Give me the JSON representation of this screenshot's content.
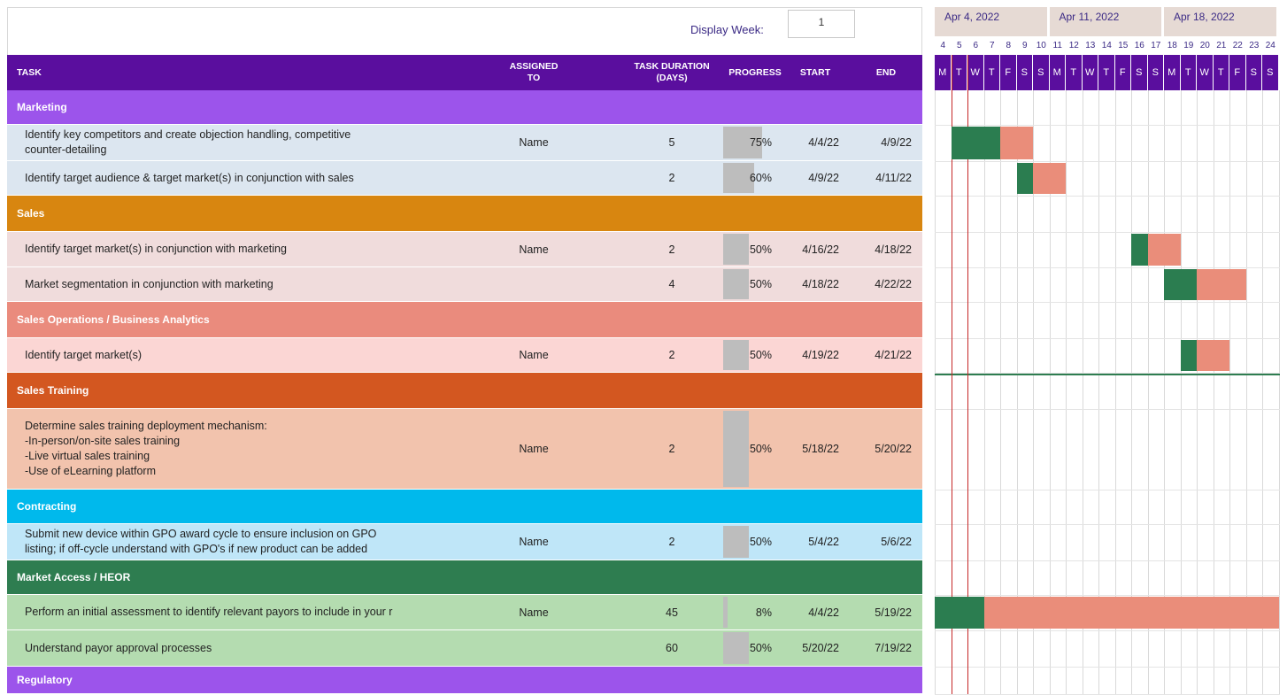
{
  "display_week": {
    "label": "Display Week:",
    "value": "1"
  },
  "columns": {
    "task": "TASK",
    "assigned_to": "ASSIGNED\nTO",
    "duration": "TASK DURATION\n(DAYS)",
    "progress": "PROGRESS",
    "start": "START",
    "end": "END"
  },
  "timeline": {
    "weeks": [
      "Apr 4, 2022",
      "Apr 11, 2022",
      "Apr 18, 2022"
    ],
    "day_numbers": [
      "4",
      "5",
      "6",
      "7",
      "8",
      "9",
      "10",
      "11",
      "12",
      "13",
      "14",
      "15",
      "16",
      "17",
      "18",
      "19",
      "20",
      "21",
      "22",
      "23",
      "24"
    ],
    "day_letters": [
      "M",
      "T",
      "W",
      "T",
      "F",
      "S",
      "S",
      "M",
      "T",
      "W",
      "T",
      "F",
      "S",
      "S",
      "M",
      "T",
      "W",
      "T",
      "F",
      "S",
      "S"
    ]
  },
  "colors": {
    "header": "#5a0e9e",
    "done_bar": "#2b7d50",
    "remaining_bar": "#ea8d7a",
    "today_line": "#c62828"
  },
  "rows": [
    {
      "type": "category",
      "name": "Marketing",
      "color": "#9c54eb"
    },
    {
      "type": "task",
      "task": "Identify key competitors and create objection handling, competitive\ncounter-detailing",
      "assigned": "Name",
      "duration": "5",
      "progress": 0.75,
      "progress_label": "75%",
      "start": "4/4/22",
      "end": "4/9/22",
      "bg": "#dce6f0"
    },
    {
      "type": "task",
      "task": "Identify target audience & target market(s) in conjunction with sales",
      "assigned": "",
      "duration": "2",
      "progress": 0.6,
      "progress_label": "60%",
      "start": "4/9/22",
      "end": "4/11/22",
      "bg": "#dce6f0"
    },
    {
      "type": "category",
      "name": "Sales",
      "color": "#d88610"
    },
    {
      "type": "task",
      "task": "Identify target market(s) in conjunction with marketing",
      "assigned": "Name",
      "duration": "2",
      "progress": 0.5,
      "progress_label": "50%",
      "start": "4/16/22",
      "end": "4/18/22",
      "bg": "#f0dcdc"
    },
    {
      "type": "task",
      "task": "Market segmentation in conjunction with marketing",
      "assigned": "",
      "duration": "4",
      "progress": 0.5,
      "progress_label": "50%",
      "start": "4/18/22",
      "end": "4/22/22",
      "bg": "#f0dcdc"
    },
    {
      "type": "category",
      "name": "Sales Operations / Business Analytics",
      "color": "#ea8b7d"
    },
    {
      "type": "task",
      "task": "Identify target market(s)",
      "assigned": "Name",
      "duration": "2",
      "progress": 0.5,
      "progress_label": "50%",
      "start": "4/19/22",
      "end": "4/21/22",
      "bg": "#fbd6d4"
    },
    {
      "type": "category",
      "name": "Sales Training",
      "color": "#d35720"
    },
    {
      "type": "task",
      "task": "Determine sales training deployment mechanism:\n-In-person/on-site sales training\n-Live virtual sales training\n-Use of eLearning platform",
      "assigned": "Name",
      "duration": "2",
      "progress": 0.5,
      "progress_label": "50%",
      "start": "5/18/22",
      "end": "5/20/22",
      "bg": "#f2c3ad"
    },
    {
      "type": "category",
      "name": "Contracting",
      "color": "#00b9ec"
    },
    {
      "type": "task",
      "task": "Submit new device within GPO award cycle to ensure inclusion on GPO\nlisting; if off-cycle understand with GPO's if new product can be added",
      "assigned": "Name",
      "duration": "2",
      "progress": 0.5,
      "progress_label": "50%",
      "start": "5/4/22",
      "end": "5/6/22",
      "bg": "#bfe6f8"
    },
    {
      "type": "category",
      "name": "Market Access / HEOR",
      "color": "#2e7d50"
    },
    {
      "type": "task",
      "task": "Perform an initial assessment to identify relevant payors to include in your r",
      "assigned": "Name",
      "duration": "45",
      "progress": 0.08,
      "progress_label": "8%",
      "start": "4/4/22",
      "end": "5/19/22",
      "bg": "#b4dcb0"
    },
    {
      "type": "task",
      "task": "Understand payor approval processes",
      "assigned": "",
      "duration": "60",
      "progress": 0.5,
      "progress_label": "50%",
      "start": "5/20/22",
      "end": "7/19/22",
      "bg": "#b4dcb0"
    },
    {
      "type": "category",
      "name": "Regulatory",
      "color": "#9c54eb"
    }
  ]
}
